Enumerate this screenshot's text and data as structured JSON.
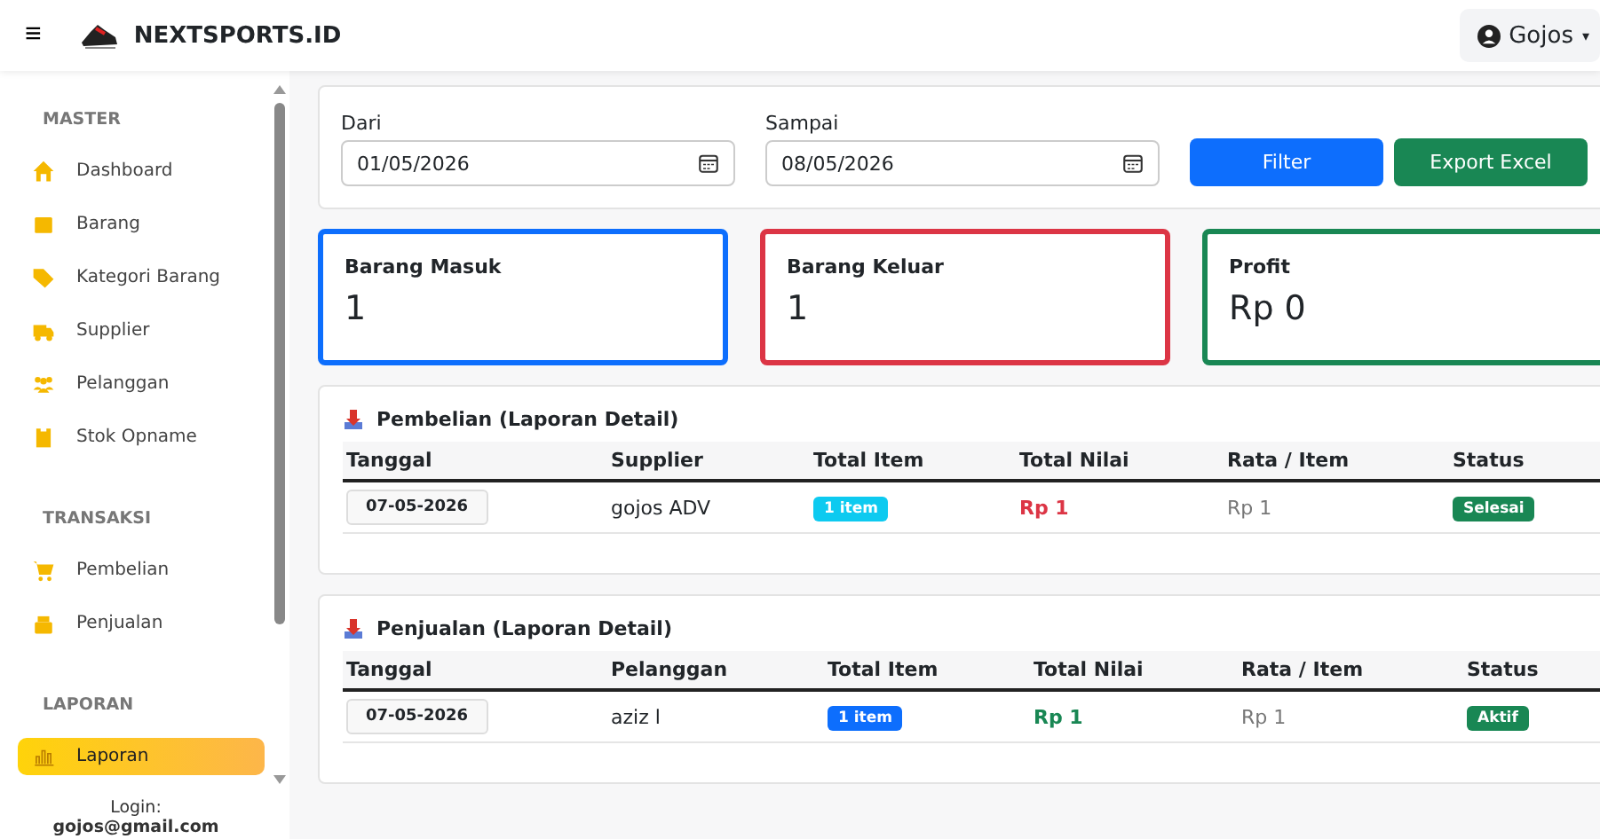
{
  "header": {
    "menu_icon": "≡",
    "brand": "NEXTSPORTS.ID",
    "user": "Gojos",
    "user_caret": "▾"
  },
  "sidebar": {
    "sections": [
      {
        "title": "MASTER",
        "items": [
          {
            "label": "Dashboard",
            "selected": false
          },
          {
            "label": "Barang",
            "selected": false
          },
          {
            "label": "Kategori Barang",
            "selected": false
          },
          {
            "label": "Supplier",
            "selected": false
          },
          {
            "label": "Pelanggan",
            "selected": false
          },
          {
            "label": "Stok Opname",
            "selected": false
          }
        ]
      },
      {
        "title": "TRANSAKSI",
        "items": [
          {
            "label": "Pembelian",
            "selected": false
          },
          {
            "label": "Penjualan",
            "selected": false
          }
        ]
      },
      {
        "title": "LAPORAN",
        "items": [
          {
            "label": "Laporan",
            "selected": true
          }
        ]
      }
    ],
    "login_label": "Login:",
    "login_email": "gojos@gmail.com"
  },
  "filter": {
    "from_label": "Dari",
    "from_value": "01/05/2026",
    "to_label": "Sampai",
    "to_value": "08/05/2026",
    "buttons": [
      "Filter",
      "Export Excel"
    ]
  },
  "stats": [
    {
      "label": "Barang Masuk",
      "value": "1",
      "color": "#0d6efd"
    },
    {
      "label": "Barang Keluar",
      "value": "1",
      "color": "#dc3545"
    },
    {
      "label": "Profit",
      "value": "Rp 0",
      "color": "#198754"
    }
  ],
  "tables": [
    {
      "title": "Pembelian (Laporan Detail)",
      "columns": [
        "Tanggal",
        "Supplier",
        "Total Item",
        "Total Nilai",
        "Rata / Item",
        "Status"
      ],
      "rows": [
        {
          "date": "07-05-2026",
          "party": "gojos ADV",
          "items": {
            "text": "1 item",
            "color": "#0dcaf0"
          },
          "total": {
            "text": "Rp 1",
            "color": "#dc3545"
          },
          "avg": "Rp 1",
          "status": "Selesai"
        }
      ]
    },
    {
      "title": "Penjualan (Laporan Detail)",
      "columns": [
        "Tanggal",
        "Pelanggan",
        "Total Item",
        "Total Nilai",
        "Rata / Item",
        "Status"
      ],
      "rows": [
        {
          "date": "07-05-2026",
          "party": "aziz l",
          "items": {
            "text": "1 item",
            "color": "#0d6efd"
          },
          "total": {
            "text": "Rp 1",
            "color": "#198754"
          },
          "avg": "Rp 1",
          "status": "Aktif"
        }
      ]
    }
  ]
}
